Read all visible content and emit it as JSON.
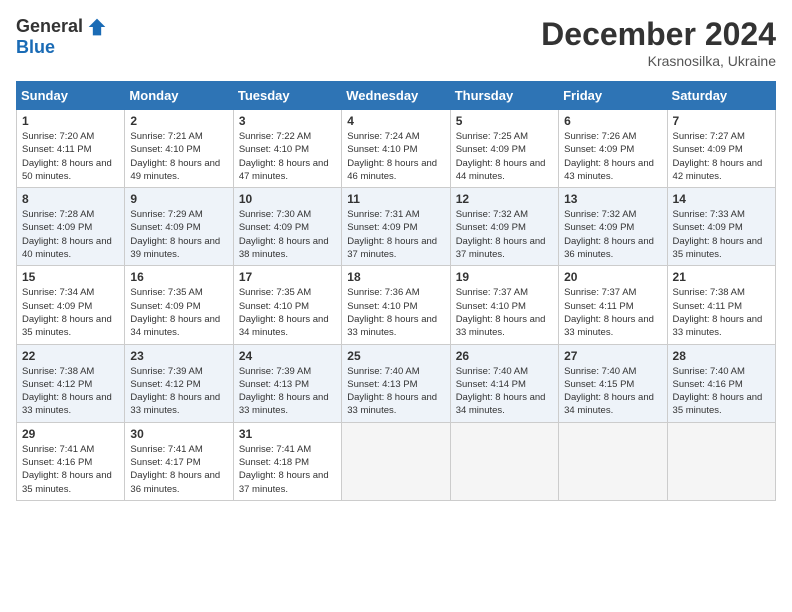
{
  "logo": {
    "general": "General",
    "blue": "Blue"
  },
  "header": {
    "title": "December 2024",
    "subtitle": "Krasnosilka, Ukraine"
  },
  "days_of_week": [
    "Sunday",
    "Monday",
    "Tuesday",
    "Wednesday",
    "Thursday",
    "Friday",
    "Saturday"
  ],
  "weeks": [
    [
      {
        "day": "1",
        "sunrise": "7:20 AM",
        "sunset": "4:11 PM",
        "daylight": "8 hours and 50 minutes."
      },
      {
        "day": "2",
        "sunrise": "7:21 AM",
        "sunset": "4:10 PM",
        "daylight": "8 hours and 49 minutes."
      },
      {
        "day": "3",
        "sunrise": "7:22 AM",
        "sunset": "4:10 PM",
        "daylight": "8 hours and 47 minutes."
      },
      {
        "day": "4",
        "sunrise": "7:24 AM",
        "sunset": "4:10 PM",
        "daylight": "8 hours and 46 minutes."
      },
      {
        "day": "5",
        "sunrise": "7:25 AM",
        "sunset": "4:09 PM",
        "daylight": "8 hours and 44 minutes."
      },
      {
        "day": "6",
        "sunrise": "7:26 AM",
        "sunset": "4:09 PM",
        "daylight": "8 hours and 43 minutes."
      },
      {
        "day": "7",
        "sunrise": "7:27 AM",
        "sunset": "4:09 PM",
        "daylight": "8 hours and 42 minutes."
      }
    ],
    [
      {
        "day": "8",
        "sunrise": "7:28 AM",
        "sunset": "4:09 PM",
        "daylight": "8 hours and 40 minutes."
      },
      {
        "day": "9",
        "sunrise": "7:29 AM",
        "sunset": "4:09 PM",
        "daylight": "8 hours and 39 minutes."
      },
      {
        "day": "10",
        "sunrise": "7:30 AM",
        "sunset": "4:09 PM",
        "daylight": "8 hours and 38 minutes."
      },
      {
        "day": "11",
        "sunrise": "7:31 AM",
        "sunset": "4:09 PM",
        "daylight": "8 hours and 37 minutes."
      },
      {
        "day": "12",
        "sunrise": "7:32 AM",
        "sunset": "4:09 PM",
        "daylight": "8 hours and 37 minutes."
      },
      {
        "day": "13",
        "sunrise": "7:32 AM",
        "sunset": "4:09 PM",
        "daylight": "8 hours and 36 minutes."
      },
      {
        "day": "14",
        "sunrise": "7:33 AM",
        "sunset": "4:09 PM",
        "daylight": "8 hours and 35 minutes."
      }
    ],
    [
      {
        "day": "15",
        "sunrise": "7:34 AM",
        "sunset": "4:09 PM",
        "daylight": "8 hours and 35 minutes."
      },
      {
        "day": "16",
        "sunrise": "7:35 AM",
        "sunset": "4:09 PM",
        "daylight": "8 hours and 34 minutes."
      },
      {
        "day": "17",
        "sunrise": "7:35 AM",
        "sunset": "4:10 PM",
        "daylight": "8 hours and 34 minutes."
      },
      {
        "day": "18",
        "sunrise": "7:36 AM",
        "sunset": "4:10 PM",
        "daylight": "8 hours and 33 minutes."
      },
      {
        "day": "19",
        "sunrise": "7:37 AM",
        "sunset": "4:10 PM",
        "daylight": "8 hours and 33 minutes."
      },
      {
        "day": "20",
        "sunrise": "7:37 AM",
        "sunset": "4:11 PM",
        "daylight": "8 hours and 33 minutes."
      },
      {
        "day": "21",
        "sunrise": "7:38 AM",
        "sunset": "4:11 PM",
        "daylight": "8 hours and 33 minutes."
      }
    ],
    [
      {
        "day": "22",
        "sunrise": "7:38 AM",
        "sunset": "4:12 PM",
        "daylight": "8 hours and 33 minutes."
      },
      {
        "day": "23",
        "sunrise": "7:39 AM",
        "sunset": "4:12 PM",
        "daylight": "8 hours and 33 minutes."
      },
      {
        "day": "24",
        "sunrise": "7:39 AM",
        "sunset": "4:13 PM",
        "daylight": "8 hours and 33 minutes."
      },
      {
        "day": "25",
        "sunrise": "7:40 AM",
        "sunset": "4:13 PM",
        "daylight": "8 hours and 33 minutes."
      },
      {
        "day": "26",
        "sunrise": "7:40 AM",
        "sunset": "4:14 PM",
        "daylight": "8 hours and 34 minutes."
      },
      {
        "day": "27",
        "sunrise": "7:40 AM",
        "sunset": "4:15 PM",
        "daylight": "8 hours and 34 minutes."
      },
      {
        "day": "28",
        "sunrise": "7:40 AM",
        "sunset": "4:16 PM",
        "daylight": "8 hours and 35 minutes."
      }
    ],
    [
      {
        "day": "29",
        "sunrise": "7:41 AM",
        "sunset": "4:16 PM",
        "daylight": "8 hours and 35 minutes."
      },
      {
        "day": "30",
        "sunrise": "7:41 AM",
        "sunset": "4:17 PM",
        "daylight": "8 hours and 36 minutes."
      },
      {
        "day": "31",
        "sunrise": "7:41 AM",
        "sunset": "4:18 PM",
        "daylight": "8 hours and 37 minutes."
      },
      null,
      null,
      null,
      null
    ]
  ]
}
